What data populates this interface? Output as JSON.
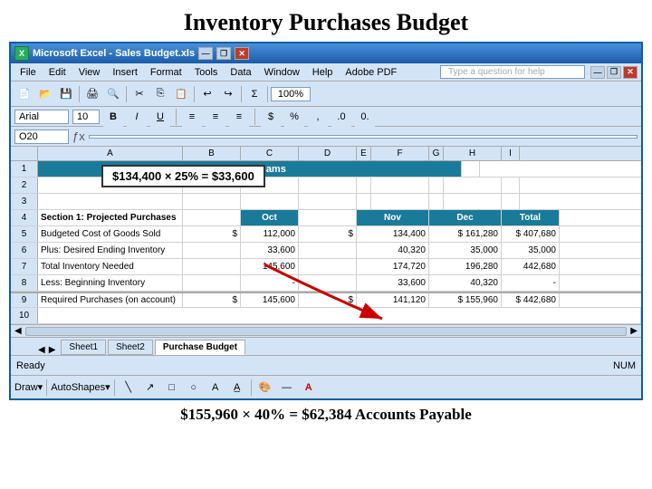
{
  "page": {
    "title": "Inventory Purchases Budget",
    "bottom_annotation": "$155,960 × 40% = $62,384 Accounts Payable"
  },
  "excel": {
    "title_bar": {
      "label": "Microsoft Excel - Sales Budget.xls",
      "icon_label": "X",
      "btn_minimize": "—",
      "btn_restore": "❐",
      "btn_close": "✕"
    },
    "menu_items": [
      "File",
      "Edit",
      "View",
      "Insert",
      "Format",
      "Tools",
      "Data",
      "Window",
      "Help",
      "Adobe PDF"
    ],
    "help_placeholder": "Type a question for help",
    "toolbar": {
      "zoom": "100%"
    },
    "formula_bar": {
      "name_box": "O20",
      "fx": "fx"
    },
    "annotation_box": "$134,400 × 25% = $33,600",
    "col_headers": [
      "A",
      "B",
      "C",
      "D",
      "E",
      "F",
      "G",
      "H",
      "I"
    ],
    "rows": [
      {
        "num": "1",
        "cells": [
          {
            "span": 9,
            "text": "Hampton Hams",
            "class": "hampton-header"
          }
        ]
      },
      {
        "num": "2",
        "cells": []
      },
      {
        "num": "3",
        "cells": []
      },
      {
        "num": "4",
        "cells": [
          {
            "text": "Section 1: Projected Purchases",
            "class": ""
          },
          {
            "text": "",
            "class": ""
          },
          {
            "text": "Oct",
            "class": "header-oct"
          },
          {
            "text": "",
            "class": ""
          },
          {
            "text": "Nov",
            "class": "header-nov"
          },
          {
            "text": "",
            "class": ""
          },
          {
            "text": "Dec",
            "class": "header-dec"
          },
          {
            "text": "",
            "class": ""
          },
          {
            "text": "Total",
            "class": "header-total"
          }
        ]
      },
      {
        "num": "5",
        "cells": [
          {
            "text": "    Budgeted Cost of Goods Sold",
            "class": ""
          },
          {
            "text": "$",
            "class": "cell-right"
          },
          {
            "text": "112,000",
            "class": "cell-right"
          },
          {
            "text": "$",
            "class": "cell-right"
          },
          {
            "text": "134,400",
            "class": "cell-right"
          },
          {
            "text": "$",
            "class": "cell-right"
          },
          {
            "text": "161,280",
            "class": "cell-right"
          },
          {
            "text": "$",
            "class": "cell-right"
          },
          {
            "text": "407,680",
            "class": "cell-right"
          }
        ]
      },
      {
        "num": "6",
        "cells": [
          {
            "text": "    Plus: Desired Ending Inventory",
            "class": ""
          },
          {
            "text": "",
            "class": ""
          },
          {
            "text": "33,600",
            "class": "cell-right"
          },
          {
            "text": "",
            "class": ""
          },
          {
            "text": "40,320",
            "class": "cell-right"
          },
          {
            "text": "",
            "class": ""
          },
          {
            "text": "35,000",
            "class": "cell-right"
          },
          {
            "text": "",
            "class": ""
          },
          {
            "text": "35,000",
            "class": "cell-right"
          }
        ]
      },
      {
        "num": "7",
        "cells": [
          {
            "text": "    Total Inventory Needed",
            "class": ""
          },
          {
            "text": "",
            "class": ""
          },
          {
            "text": "145,600",
            "class": "cell-right"
          },
          {
            "text": "",
            "class": ""
          },
          {
            "text": "174,720",
            "class": "cell-right"
          },
          {
            "text": "",
            "class": ""
          },
          {
            "text": "196,280",
            "class": "cell-right"
          },
          {
            "text": "",
            "class": ""
          },
          {
            "text": "442,680",
            "class": "cell-right"
          }
        ]
      },
      {
        "num": "8",
        "cells": [
          {
            "text": "    Less: Beginning Inventory",
            "class": ""
          },
          {
            "text": "",
            "class": ""
          },
          {
            "text": "-",
            "class": "cell-right"
          },
          {
            "text": "",
            "class": ""
          },
          {
            "text": "33,600",
            "class": "cell-right"
          },
          {
            "text": "",
            "class": ""
          },
          {
            "text": "40,320",
            "class": "cell-right"
          },
          {
            "text": "",
            "class": ""
          },
          {
            "text": "-",
            "class": "cell-right"
          }
        ]
      },
      {
        "num": "9",
        "cells": [
          {
            "text": "    Required Purchases (on account)",
            "class": ""
          },
          {
            "text": "$",
            "class": "cell-right"
          },
          {
            "text": "145,600",
            "class": "cell-right"
          },
          {
            "text": "$",
            "class": "cell-right"
          },
          {
            "text": "141,120",
            "class": "cell-right"
          },
          {
            "text": "$",
            "class": "cell-right"
          },
          {
            "text": "155,960",
            "class": "cell-right"
          },
          {
            "text": "$",
            "class": "cell-right"
          },
          {
            "text": "442,680",
            "class": "cell-right"
          }
        ]
      }
    ],
    "sheet_tabs": [
      "Sheet1",
      "Sheet2",
      "Purchase Budget"
    ],
    "active_tab": "Purchase Budget",
    "status": {
      "ready": "Ready",
      "num": "NUM"
    }
  }
}
